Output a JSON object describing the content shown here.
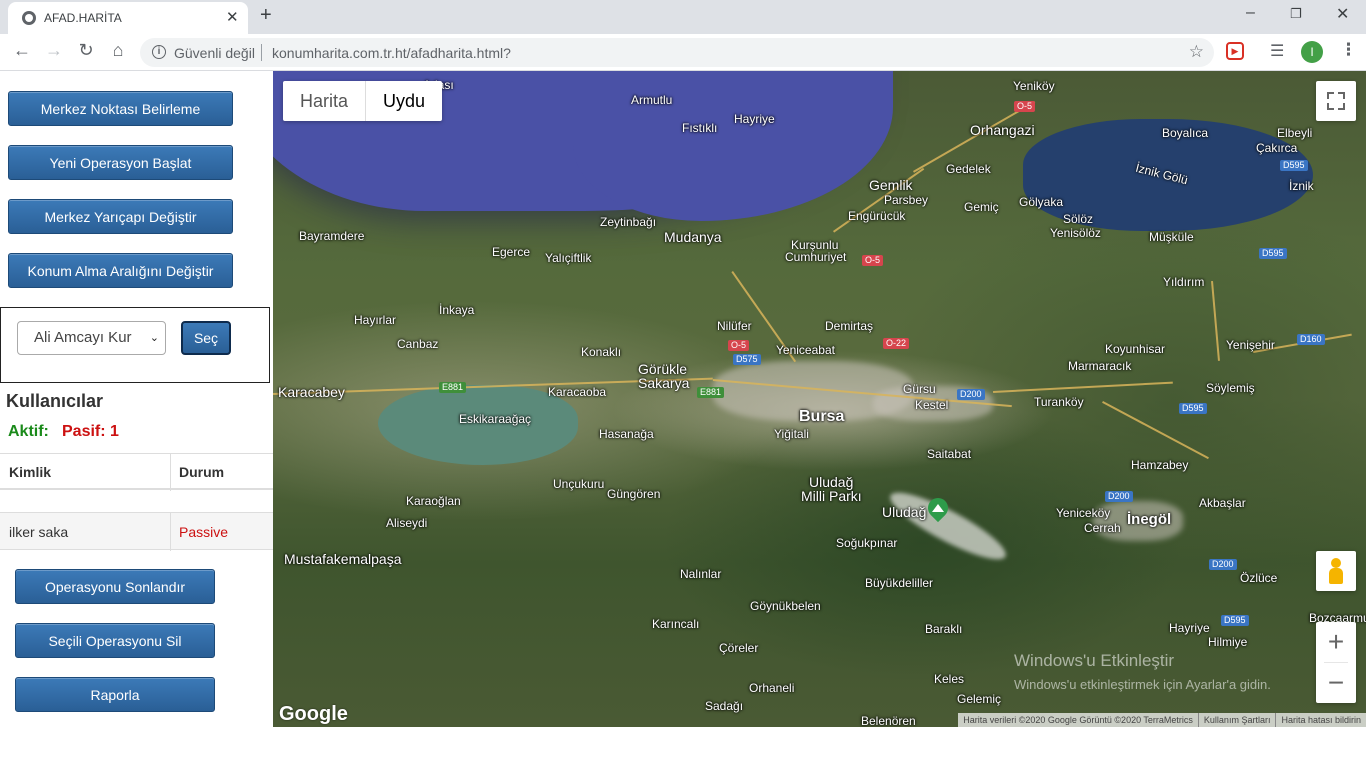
{
  "browser": {
    "tab_title": "AFAD.HARİTA",
    "tab_close": "✕",
    "new_tab": "+",
    "security_label": "Güvenli değil",
    "url": "konumharita.com.tr.ht/afadharita.html?",
    "avatar_initial": "I",
    "minimize": "–",
    "restore": "❐",
    "close": "✕"
  },
  "panel": {
    "buttons": {
      "center_point": "Merkez Noktası Belirleme",
      "new_operation": "Yeni Operasyon Başlat",
      "change_radius": "Merkez Yarıçapı Değiştir",
      "change_interval": "Konum Alma Aralığını Değiştir",
      "end_operation": "Operasyonu Sonlandır",
      "delete_operation": "Seçili Operasyonu Sil",
      "report": "Raporla"
    },
    "select_value": "Ali Amcayı Kur",
    "select_button": "Seç",
    "users_title": "Kullanıcılar",
    "active_label": "Aktif:",
    "passive_label": "Pasif: 1",
    "table": {
      "headers": [
        "Kimlik",
        "Durum"
      ],
      "rows": [
        {
          "id": "ilker saka",
          "status": "Passive"
        }
      ]
    }
  },
  "map": {
    "type_buttons": [
      "Harita",
      "Uydu"
    ],
    "active_type": "Uydu",
    "zoom_in": "+",
    "zoom_out": "−",
    "logo": "Google",
    "attribution": [
      "Harita verileri ©2020 Google Görüntü ©2020 TerraMetrics",
      "Kullanım Şartları",
      "Harita hatası bildirin"
    ],
    "watermark_title": "Windows'u Etkinleştir",
    "watermark_text": "Windows'u etkinleştirmek için Ayarlar'a gidin.",
    "labels": {
      "armutlu": "Armutlu",
      "fistikli": "Fıstıklı",
      "hayriye": "Hayriye",
      "orhangazi": "Orhangazi",
      "yenikoy": "Yeniköy",
      "boyalica": "Boyalıca",
      "elbeyli": "Elbeyli",
      "cakirca": "Çakırca",
      "iznik_golu": "İznik Gölü",
      "iznik": "İznik",
      "gemlik": "Gemlik",
      "gedelek": "Gedelek",
      "parsbey": "Parsbey",
      "engurucuk": "Engürücük",
      "gemic": "Gemiç",
      "golyaka": "Gölyaka",
      "soloz": "Sölöz",
      "yenisoloz": "Yenisölöz",
      "muskule": "Müşküle",
      "yildirim": "Yıldırım",
      "zeytinbagi": "Zeytinbağı",
      "mudanya": "Mudanya",
      "kursunlu": "Kurşunlu",
      "cumhuriyet": "Cumhuriyet",
      "bayramdere": "Bayramdere",
      "egerce": "Egerce",
      "yaliciftlik": "Yalıçiftlik",
      "inkaya": "İnkaya",
      "hayirlar": "Hayırlar",
      "canbaz": "Canbaz",
      "nilufer": "Nilüfer",
      "demirtas": "Demirtaş",
      "konakli": "Konaklı",
      "gorukle": "Görükle",
      "sakarya": "Sakarya",
      "yeniceabat": "Yeniceabat",
      "koyunhisar": "Koyunhisar",
      "yenisehir": "Yenişehir",
      "marmaracik": "Marmaracık",
      "karacabey": "Karacabey",
      "karacaoba": "Karacaoba",
      "gursu": "Gürsu",
      "kestel": "Kestel",
      "turankoy": "Turanköy",
      "soylemis": "Söylemiş",
      "bursa": "Bursa",
      "eskikaraagac": "Eskikaraağaç",
      "hasanaga": "Hasanağa",
      "yigitali": "Yiğitali",
      "saitabat": "Saitabat",
      "hamzabey": "Hamzabey",
      "uncukuru": "Unçukuru",
      "gungoren": "Güngören",
      "uludag_mp": "Uludağ",
      "milli_parki": "Milli Parkı",
      "akbaslar": "Akbaşlar",
      "karaoglan": "Karaoğlan",
      "aliseydi": "Aliseydi",
      "uludag": "Uludağ",
      "yeniceköy": "Yeniceköy",
      "cerrah": "Cerrah",
      "inegol": "İnegöl",
      "mustafakemalpasa": "Mustafakemalpaşa",
      "sogukpinar": "Soğukpınar",
      "nalinlar": "Nalınlar",
      "buyukdeliller": "Büyükdeliller",
      "ozluce": "Özlüce",
      "goynukbelen": "Göynükbelen",
      "bozcaarmut": "Bozcaarmu",
      "karincali": "Karıncalı",
      "hayriye2": "Hayriye",
      "hilmiye": "Hilmiye",
      "baraklı": "Baraklı",
      "coreler": "Çöreler",
      "orhaneli": "Orhaneli",
      "keles": "Keles",
      "gelemic": "Gelemiç",
      "sadagi": "Sadağı",
      "belenoren": "Belenören",
      "adasi": "Adası",
      "ta": "Ta"
    },
    "shields": {
      "o5a": "O-5",
      "o5b": "O-5",
      "o5c": "O-5",
      "o22": "O-22",
      "d575": "D575",
      "e881a": "E881",
      "e881b": "E881",
      "d200a": "D200",
      "d200b": "D200",
      "d200c": "D200",
      "d595a": "D595",
      "d595b": "D595",
      "d595c": "D595",
      "d595d": "D595",
      "d160": "D160"
    }
  }
}
